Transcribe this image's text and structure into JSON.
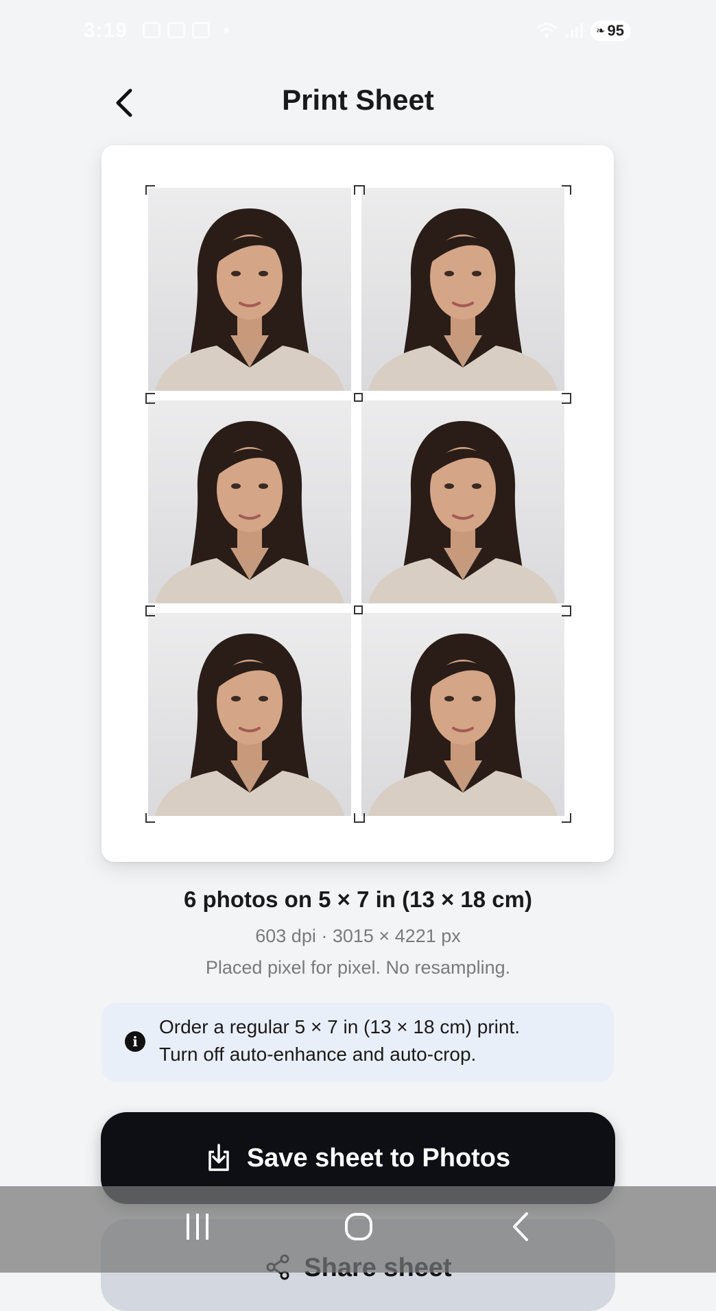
{
  "status_bar": {
    "time": "3:19",
    "battery": "95"
  },
  "header": {
    "title": "Print Sheet"
  },
  "sheet": {
    "photos": [
      {
        "id": 1
      },
      {
        "id": 2
      },
      {
        "id": 3
      },
      {
        "id": 4
      },
      {
        "id": 5
      },
      {
        "id": 6
      }
    ]
  },
  "info": {
    "title": "6 photos on 5 × 7 in (13 × 18 cm)",
    "spec": "603 dpi · 3015 × 4221 px",
    "note": "Placed pixel for pixel. No resampling."
  },
  "notice": {
    "icon": "info-icon",
    "line1": "Order a regular 5 × 7 in (13 × 18 cm) print.",
    "line2": "Turn off auto-enhance and auto-crop."
  },
  "actions": {
    "save_label": "Save sheet to Photos",
    "share_label": "Share sheet"
  },
  "colors": {
    "primary_button": "#0d0f14",
    "notice_bg": "#e9eff9",
    "page_bg": "#f3f4f6"
  }
}
